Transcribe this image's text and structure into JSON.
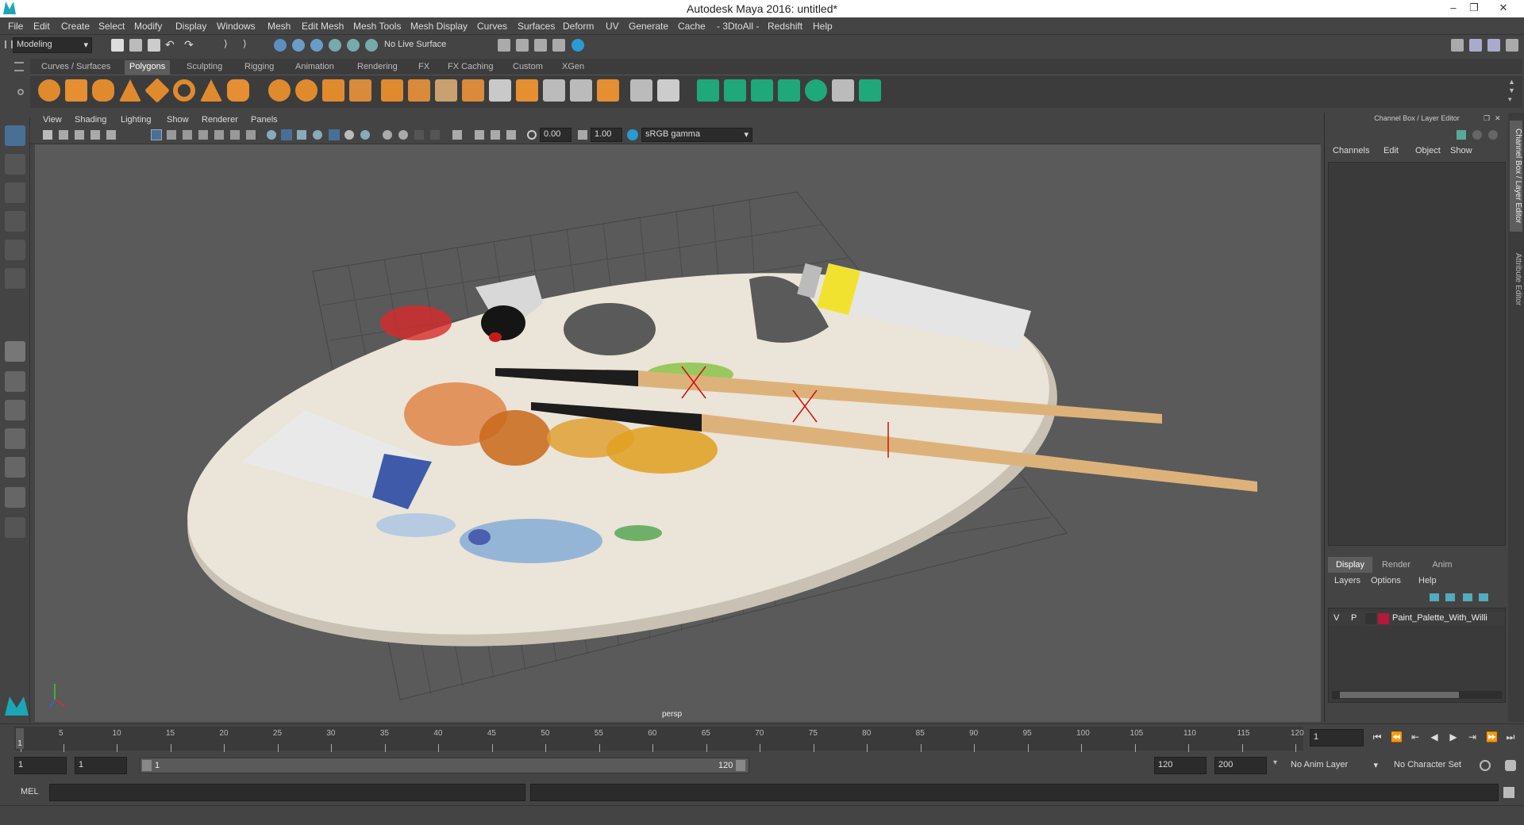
{
  "window": {
    "title": "Autodesk Maya 2016: untitled*",
    "minimize": "–",
    "restore": "❐",
    "close": "✕"
  },
  "menubar": [
    "File",
    "Edit",
    "Create",
    "Select",
    "Modify",
    "Display",
    "Windows",
    "Mesh",
    "Edit Mesh",
    "Mesh Tools",
    "Mesh Display",
    "Curves",
    "Surfaces",
    "Deform",
    "UV",
    "Generate",
    "Cache",
    "- 3DtoAll -",
    "Redshift",
    "Help"
  ],
  "status": {
    "mode": "Modeling",
    "live_surface": "No Live Surface"
  },
  "shelf_tabs": [
    "Curves / Surfaces",
    "Polygons",
    "Sculpting",
    "Rigging",
    "Animation",
    "Rendering",
    "FX",
    "FX Caching",
    "Custom",
    "XGen"
  ],
  "shelf_active": "Polygons",
  "viewport": {
    "menus": [
      "View",
      "Shading",
      "Lighting",
      "Show",
      "Renderer",
      "Panels"
    ],
    "exposure": "0.00",
    "gamma": "1.00",
    "color_space": "sRGB gamma",
    "camera_label": "persp"
  },
  "channel_box": {
    "header": "Channel Box / Layer Editor",
    "menus": [
      "Channels",
      "Edit",
      "Object",
      "Show"
    ]
  },
  "layer_editor": {
    "tabs": [
      "Display",
      "Render",
      "Anim"
    ],
    "active_tab": "Display",
    "menus": [
      "Layers",
      "Options",
      "Help"
    ],
    "layers": [
      {
        "v": "V",
        "p": "P",
        "color": "#b4193a",
        "name": "Paint_Palette_With_Willi"
      }
    ]
  },
  "side_tabs": [
    "Channel Box / Layer Editor",
    "Attribute Editor"
  ],
  "timeline": {
    "ticks": [
      "1",
      "5",
      "10",
      "15",
      "20",
      "25",
      "30",
      "35",
      "40",
      "45",
      "50",
      "55",
      "60",
      "65",
      "70",
      "75",
      "80",
      "85",
      "90",
      "95",
      "100",
      "105",
      "110",
      "115",
      "120"
    ],
    "current_frame": "1",
    "frame_field": "1"
  },
  "range": {
    "start": "1",
    "playback_start": "1",
    "slider_start": "1",
    "slider_end": "120",
    "playback_end": "120",
    "end": "200",
    "anim_layer": "No Anim Layer",
    "character_set": "No Character Set"
  },
  "command": {
    "language": "MEL"
  },
  "colors": {
    "maya_teal": "#1aa6b7",
    "layer_red": "#b4193a",
    "active_blue": "#4a6f95"
  }
}
